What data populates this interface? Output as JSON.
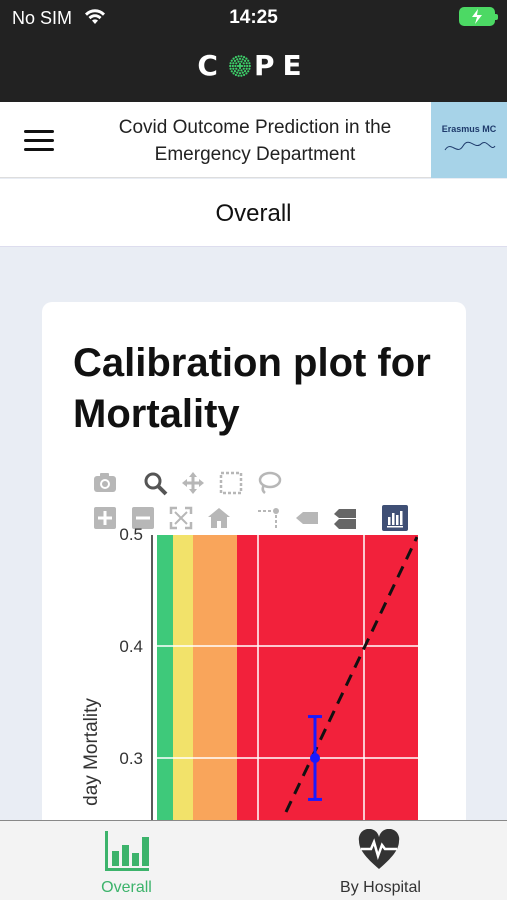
{
  "status_bar": {
    "carrier": "No SIM",
    "time": "14:25",
    "battery": "charging"
  },
  "brand": {
    "left": "C",
    "right": "PE"
  },
  "header": {
    "title": "Covid Outcome Prediction in the Emergency Department",
    "logo_text": "Erasmus MC"
  },
  "page": {
    "title": "Overall"
  },
  "card": {
    "title": "Calibration plot for Mortality",
    "modebar": [
      "camera-icon",
      "zoom-icon",
      "pan-icon",
      "box-select-icon",
      "lasso-select-icon",
      "zoom-in-icon",
      "zoom-out-icon",
      "autoscale-icon",
      "reset-axes-icon",
      "spike-lines-icon",
      "hover-closest-icon",
      "hover-compare-icon",
      "plotly-logo-icon"
    ]
  },
  "chart_data": {
    "type": "scatter",
    "ylabel": "day Mortality",
    "yticks": [
      "0.5",
      "0.4",
      "0.3"
    ],
    "y_range_visible": [
      0.24,
      0.5
    ],
    "risk_bands": [
      {
        "color": "#3ec97a"
      },
      {
        "color": "#f2e26a"
      },
      {
        "color": "#f9a55b"
      },
      {
        "color": "#f2213b"
      }
    ],
    "points": [
      {
        "y": 0.3,
        "y_low": 0.263,
        "y_high": 0.337,
        "color": "#1a1aff"
      }
    ],
    "reference_line": "dashed diagonal"
  },
  "tabs": [
    {
      "label": "Overall",
      "active": true,
      "color": "#3cb36b"
    },
    {
      "label": "By Hospital",
      "active": false
    }
  ]
}
